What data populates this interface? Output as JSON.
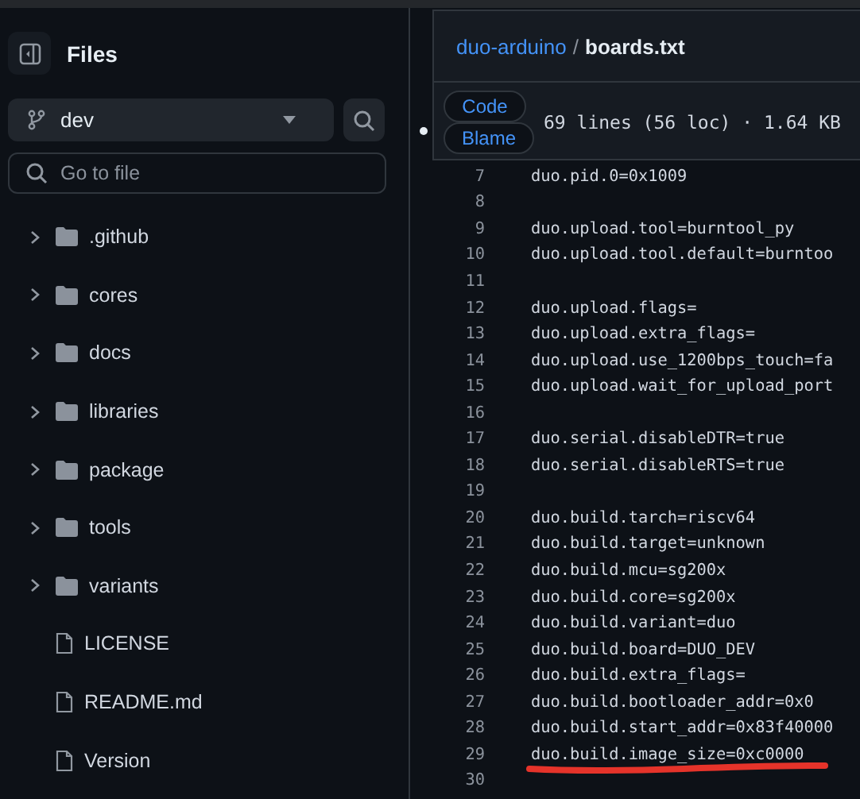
{
  "sidebar": {
    "title": "Files",
    "branch": "dev",
    "search": {
      "placeholder": "Go to file"
    },
    "tree": [
      {
        "kind": "folder",
        "name": ".github",
        "expanded": false
      },
      {
        "kind": "folder",
        "name": "cores",
        "expanded": false
      },
      {
        "kind": "folder",
        "name": "docs",
        "expanded": false
      },
      {
        "kind": "folder",
        "name": "libraries",
        "expanded": false
      },
      {
        "kind": "folder",
        "name": "package",
        "expanded": false
      },
      {
        "kind": "folder",
        "name": "tools",
        "expanded": false
      },
      {
        "kind": "folder",
        "name": "variants",
        "expanded": false
      },
      {
        "kind": "file",
        "name": "LICENSE"
      },
      {
        "kind": "file",
        "name": "README.md"
      },
      {
        "kind": "file",
        "name": "Version"
      }
    ]
  },
  "header": {
    "breadcrumb": [
      {
        "kind": "link",
        "text": "duo-arduino"
      },
      {
        "kind": "sep",
        "text": "/"
      },
      {
        "kind": "current",
        "text": "boards.txt"
      }
    ],
    "tabs": [
      {
        "label": "Code",
        "selected": false
      },
      {
        "label": "Blame",
        "selected": false
      }
    ],
    "info": "69 lines (56 loc) · 1.64 KB"
  },
  "code": [
    {
      "n": "7",
      "text": "duo.pid.0=0x1009"
    },
    {
      "n": "8"
    },
    {
      "n": "9",
      "text": "duo.upload.tool=burntool_py"
    },
    {
      "n": "10",
      "text": "duo.upload.tool.default=burntoo"
    },
    {
      "n": "11"
    },
    {
      "n": "12",
      "text": "duo.upload.flags="
    },
    {
      "n": "13",
      "text": "duo.upload.extra_flags="
    },
    {
      "n": "14",
      "text": "duo.upload.use_1200bps_touch=fa"
    },
    {
      "n": "15",
      "text": "duo.upload.wait_for_upload_port"
    },
    {
      "n": "16"
    },
    {
      "n": "17",
      "text": "duo.serial.disableDTR=true"
    },
    {
      "n": "18",
      "text": "duo.serial.disableRTS=true"
    },
    {
      "n": "19"
    },
    {
      "n": "20",
      "text": "duo.build.tarch=riscv64"
    },
    {
      "n": "21",
      "text": "duo.build.target=unknown"
    },
    {
      "n": "22",
      "text": "duo.build.mcu=sg200x"
    },
    {
      "n": "23",
      "text": "duo.build.core=sg200x"
    },
    {
      "n": "24",
      "text": "duo.build.variant=duo"
    },
    {
      "n": "25",
      "text": "duo.build.board=DUO_DEV"
    },
    {
      "n": "26",
      "text": "duo.build.extra_flags="
    },
    {
      "n": "27",
      "text": "duo.build.bootloader_addr=0x0"
    },
    {
      "n": "28",
      "text": "duo.build.start_addr=0x83f40000"
    },
    {
      "n": "29",
      "text": "duo.build.image_size=0xc0000",
      "underlined": true
    },
    {
      "n": "30"
    }
  ]
}
